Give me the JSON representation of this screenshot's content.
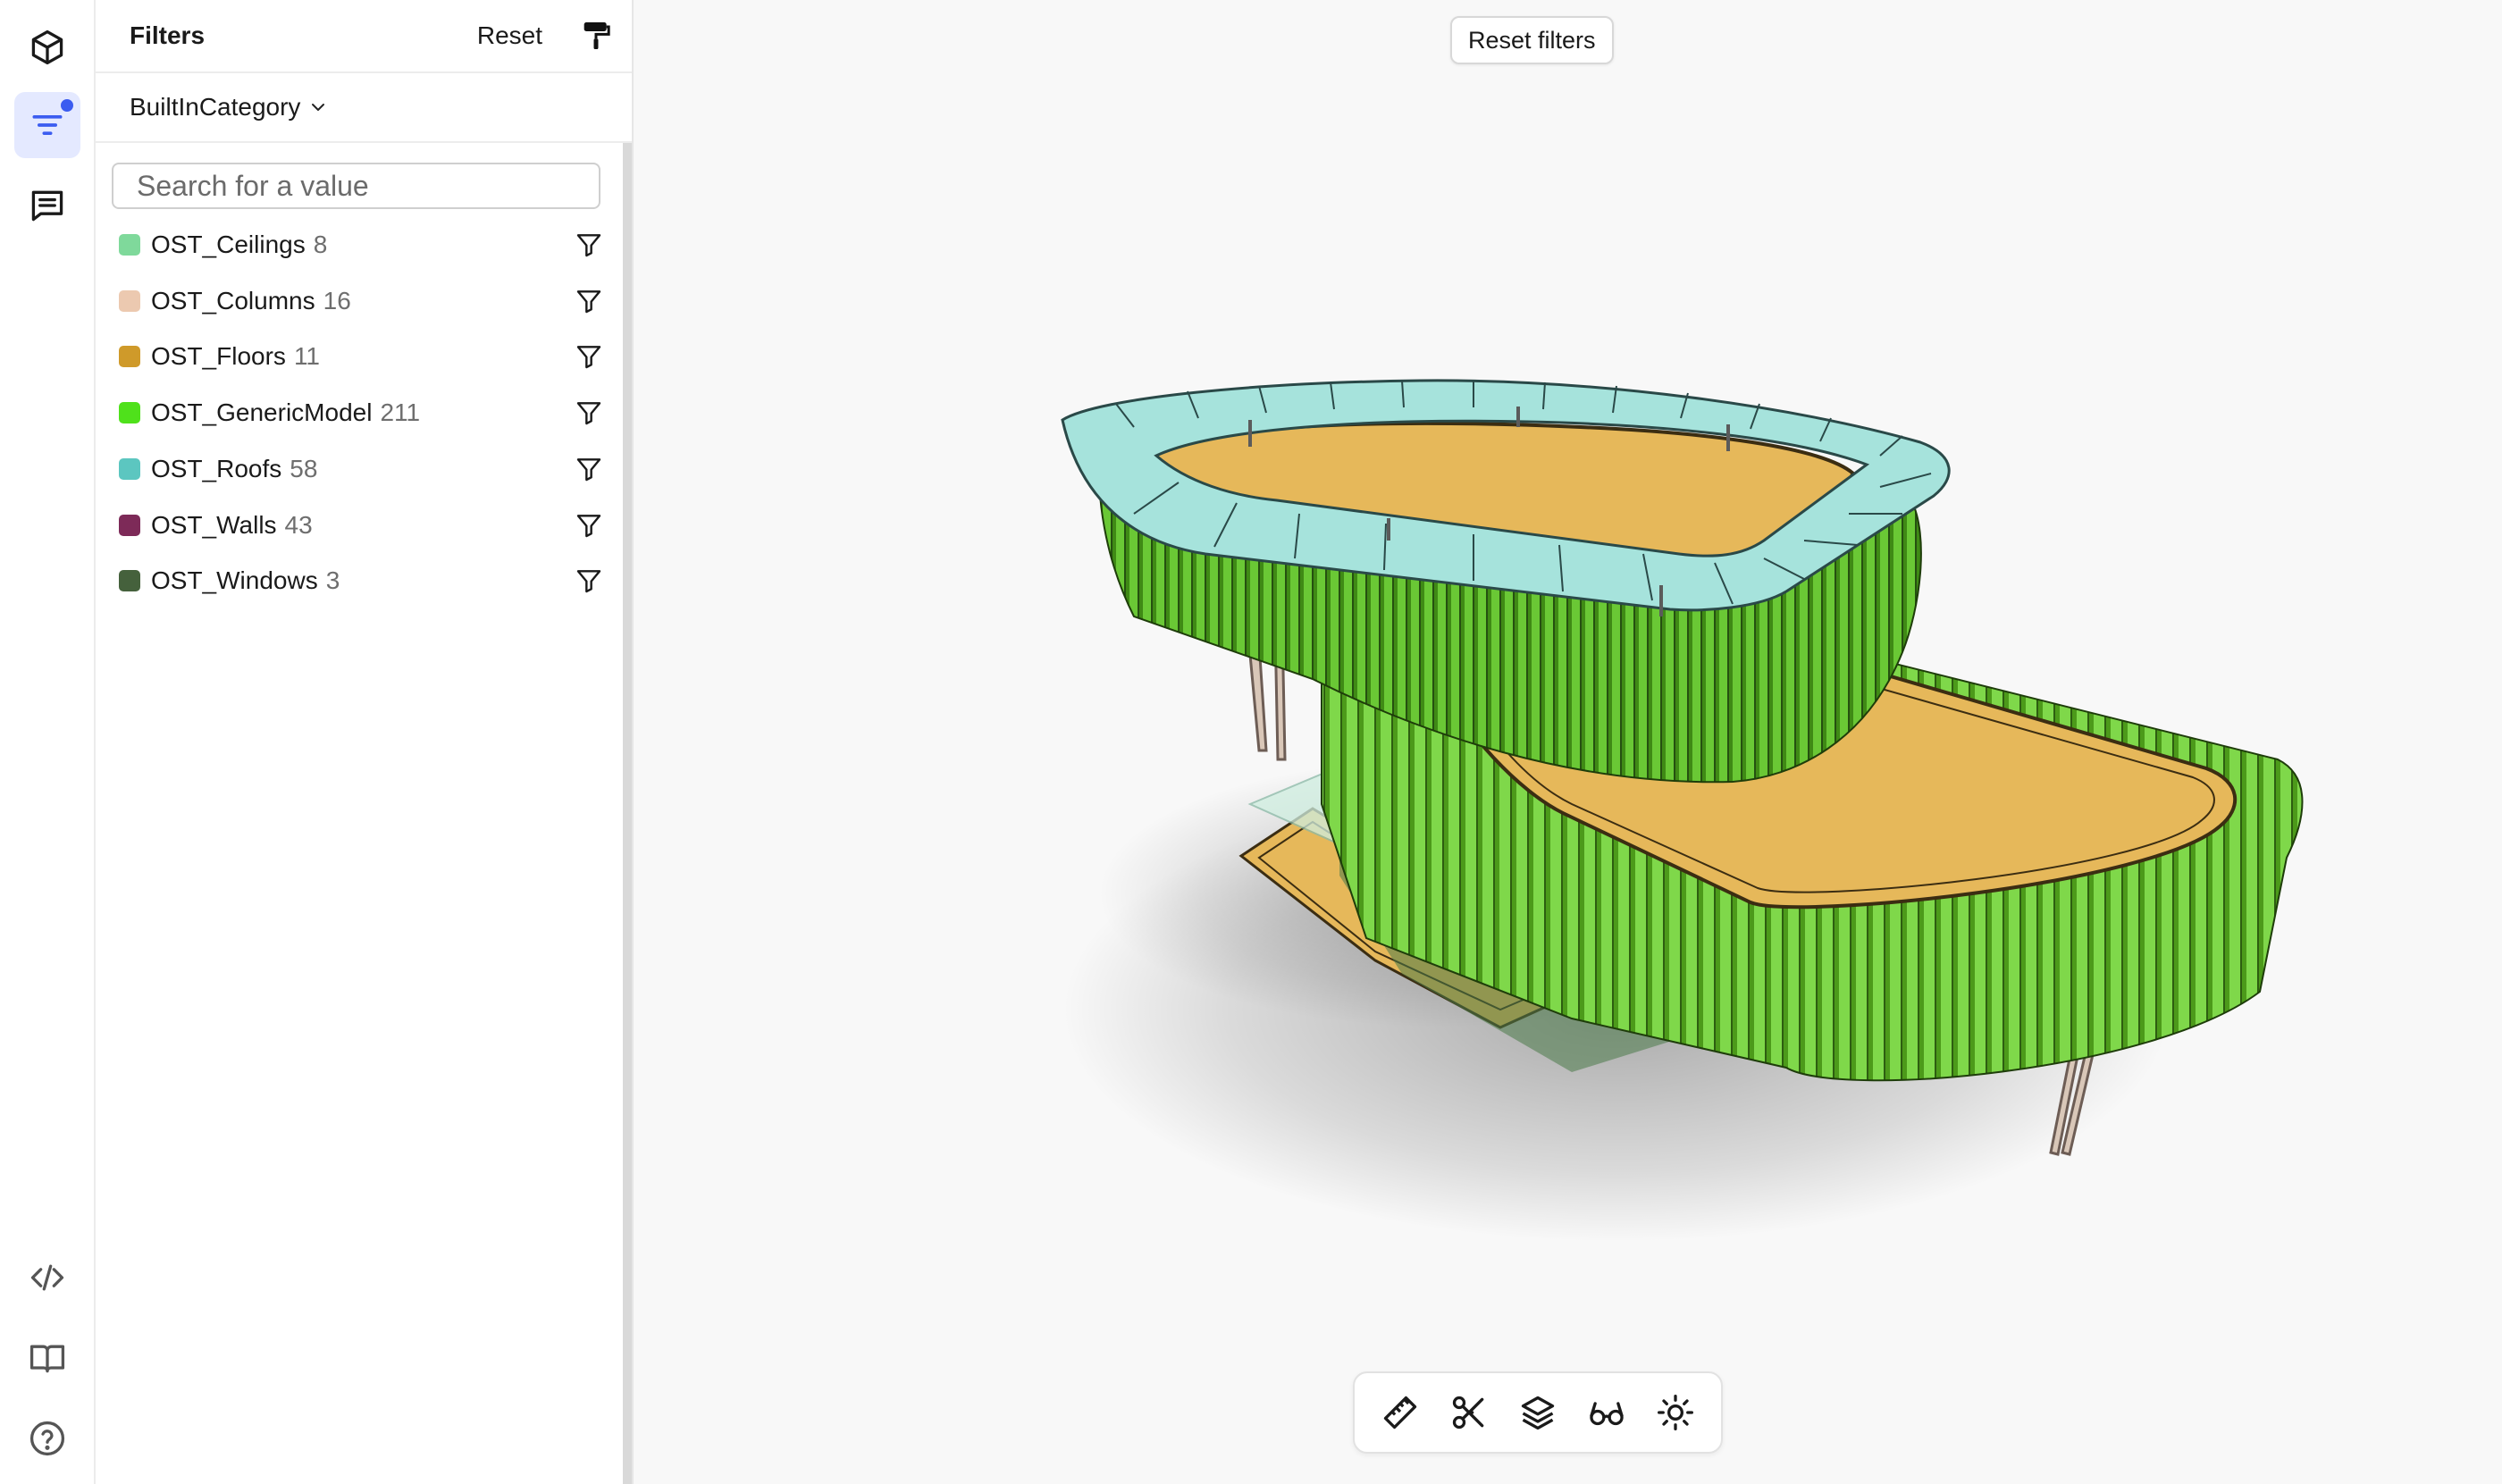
{
  "rail": {
    "items": [
      {
        "name": "model-icon"
      },
      {
        "name": "filter-icon",
        "active": true,
        "badge": true
      },
      {
        "name": "comments-icon"
      },
      {
        "name": "code-icon"
      },
      {
        "name": "docs-icon"
      },
      {
        "name": "help-icon"
      }
    ]
  },
  "panel": {
    "title": "Filters",
    "reset_label": "Reset",
    "category": "BuiltInCategory",
    "search_placeholder": "Search for a value",
    "filters": [
      {
        "name": "OST_Ceilings",
        "count": "8",
        "color": "#7fd99b"
      },
      {
        "name": "OST_Columns",
        "count": "16",
        "color": "#ecc9b0"
      },
      {
        "name": "OST_Floors",
        "count": "11",
        "color": "#cf9a2a"
      },
      {
        "name": "OST_GenericModel",
        "count": "211",
        "color": "#4fe11b"
      },
      {
        "name": "OST_Roofs",
        "count": "58",
        "color": "#5cc6c0"
      },
      {
        "name": "OST_Walls",
        "count": "43",
        "color": "#7d2a58"
      },
      {
        "name": "OST_Windows",
        "count": "3",
        "color": "#45613c"
      }
    ]
  },
  "viewer": {
    "reset_filters_label": "Reset filters",
    "toolbar": [
      "ruler-icon",
      "scissors-icon",
      "layers-icon",
      "glasses-icon",
      "sun-icon"
    ]
  }
}
